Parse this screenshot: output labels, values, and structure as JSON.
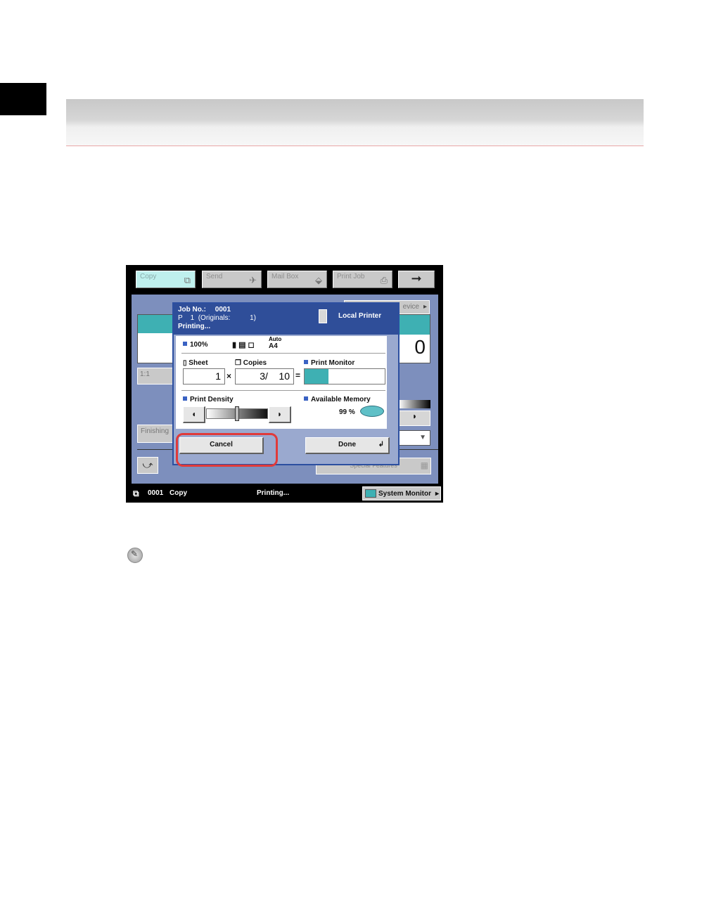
{
  "tabs": [
    {
      "label": "Copy",
      "icon": "copy-tab-icon"
    },
    {
      "label": "Send",
      "icon": "paper-plane-icon"
    },
    {
      "label": "Mail Box",
      "icon": "mailbox-icon"
    },
    {
      "label": "Print Job",
      "icon": "printer-icon"
    },
    {
      "icon": "right-arrow-icon",
      "glyph": "➞"
    }
  ],
  "background": {
    "device_label": "evice",
    "counter": "0",
    "ratio": "1:1",
    "finishing": "Finishing",
    "special_features": "Special Features"
  },
  "dialog": {
    "job_no_label": "Job No.:",
    "job_no": "0001",
    "page_line": "P    1  (Originals:          1)",
    "status": "Printing...",
    "printer_name": "Local Printer",
    "zoom": "100%",
    "paper_auto": "Auto",
    "paper_size": "A4",
    "sheet_label": "Sheet",
    "copies_label": "Copies",
    "print_monitor_label": "Print Monitor",
    "sheet_value": "1",
    "times_sign": "×",
    "copies_value": "3/    10",
    "equals_sign": "=",
    "print_progress": 0.3,
    "print_density_label": "Print Density",
    "density_level": 0.5,
    "available_memory_label": "Available Memory",
    "available_memory": "99 %",
    "cancel_label": "Cancel",
    "done_label": "Done"
  },
  "statusbar": {
    "job_id": "0001",
    "job_type": "Copy",
    "status": "Printing...",
    "system_monitor_label": "System Monitor"
  },
  "colors": {
    "accent": "#2f4e99",
    "highlight": "#e03a3a",
    "progress": "#3eb0b3",
    "screen_bg": "#7d8fbd"
  }
}
